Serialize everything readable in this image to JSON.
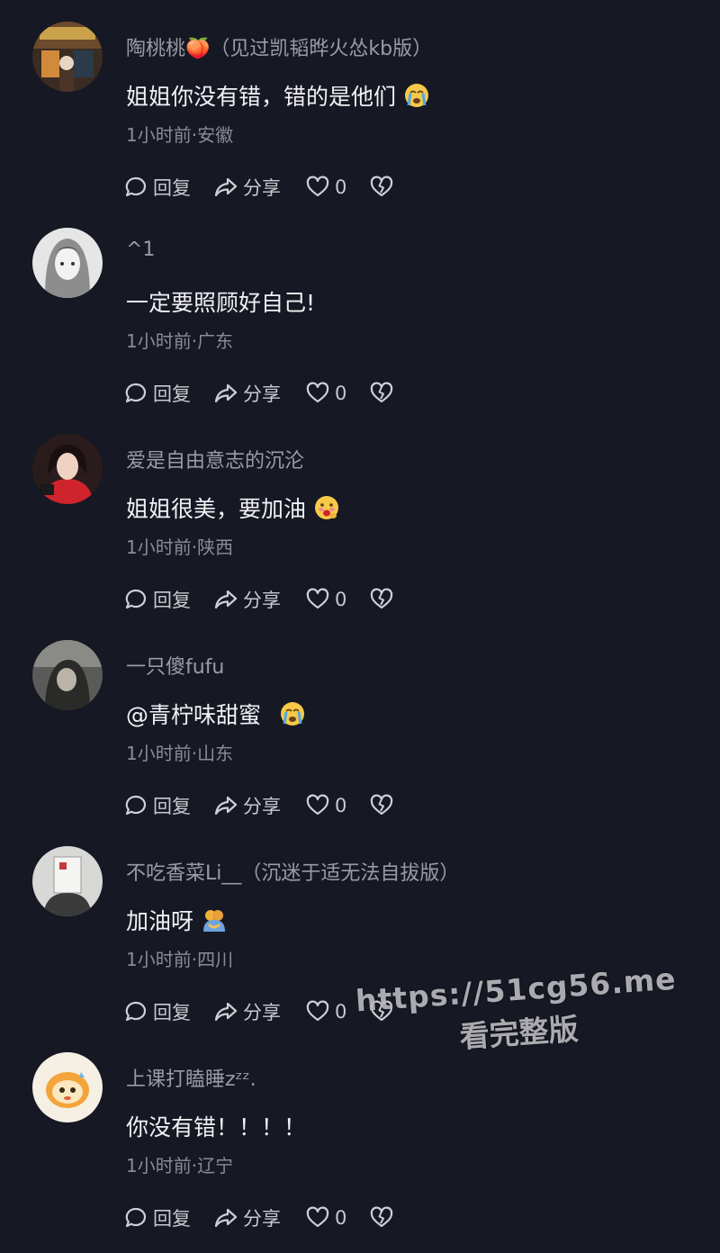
{
  "actions": {
    "reply_label": "回复",
    "share_label": "分享"
  },
  "watermark": {
    "url": "https://51cg56.me",
    "subtitle": "看完整版"
  },
  "comments": [
    {
      "nickname": "陶桃桃🍑（见过凯韬晔火怂kb版）",
      "text": "姐姐你没有错，错的是他们",
      "emoji": "loudly-crying-face",
      "meta": "1小时前·安徽",
      "likes": "0",
      "avatar_icon": "avatar-shop-photo"
    },
    {
      "nickname": "^1",
      "text": "一定要照顾好自己!",
      "emoji": "",
      "meta": "1小时前·广东",
      "likes": "0",
      "avatar_icon": "avatar-anime-sketch"
    },
    {
      "nickname": "爱是自由意志的沉沦",
      "text": "姐姐很美，要加油",
      "emoji": "face-with-hand-over-mouth-blush",
      "meta": "1小时前·陕西",
      "likes": "0",
      "avatar_icon": "avatar-girl-red"
    },
    {
      "nickname": "一只傻fufu",
      "text": "@青柠味甜蜜",
      "emoji": "loudly-crying-face",
      "meta": "1小时前·山东",
      "likes": "0",
      "avatar_icon": "avatar-dark-portrait"
    },
    {
      "nickname": "不吃香菜Li__（沉迷于适无法自拔版）",
      "text": "加油呀",
      "emoji": "people-hugging",
      "meta": "1小时前·四川",
      "likes": "0",
      "avatar_icon": "avatar-white-box"
    },
    {
      "nickname": "上课打瞌睡zᶻᶻ.",
      "text": "你没有错！！！！",
      "emoji": "",
      "meta": "1小时前·辽宁",
      "likes": "0",
      "avatar_icon": "avatar-cartoon-egg"
    }
  ]
}
